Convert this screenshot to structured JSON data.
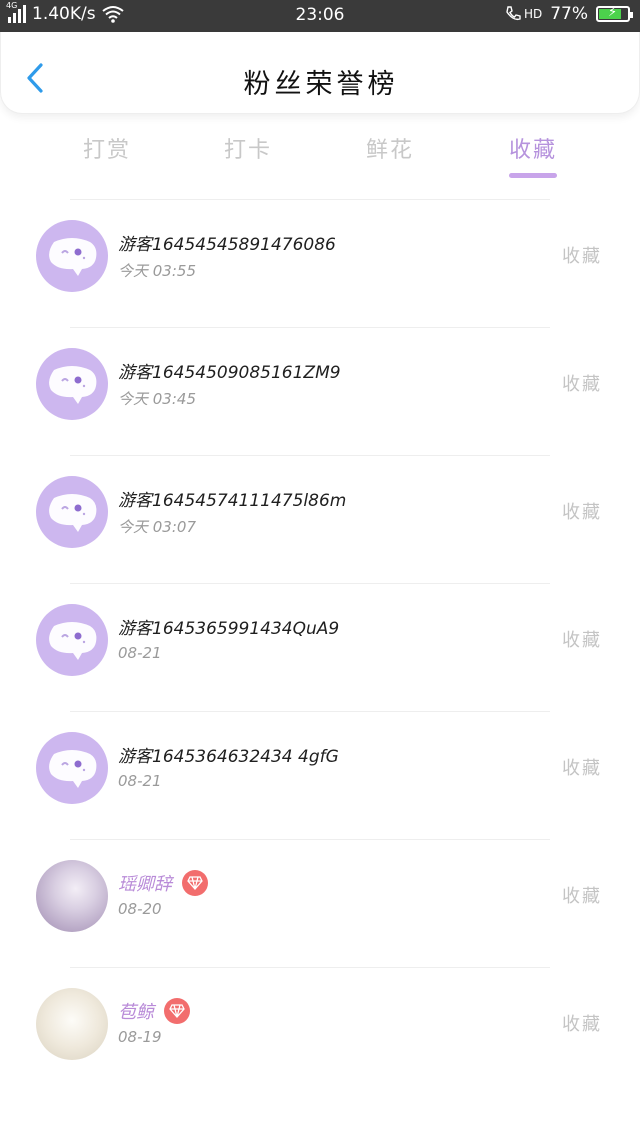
{
  "status_bar": {
    "network": "4G",
    "speed": "1.40K/s",
    "time": "23:06",
    "hd": "HD",
    "battery": "77%",
    "battery_level": 0.77,
    "battery_color": "#4cd24c"
  },
  "header": {
    "title": "粉丝荣誉榜",
    "back_icon": "chevron-left-icon"
  },
  "tabs": [
    {
      "label": "打赏",
      "active": false
    },
    {
      "label": "打卡",
      "active": false
    },
    {
      "label": "鲜花",
      "active": false
    },
    {
      "label": "收藏",
      "active": true
    }
  ],
  "colors": {
    "accent": "#b693dd",
    "guest_avatar": "#cdb7ef",
    "badge": "#f26d6d"
  },
  "fans": [
    {
      "name": "游客16454545891476086",
      "date": "今天 03:55",
      "action": "收藏",
      "avatar": "guest"
    },
    {
      "name": "游客16454509085161ZM9",
      "date": "今天 03:45",
      "action": "收藏",
      "avatar": "guest"
    },
    {
      "name": "游客16454574111475l86m",
      "date": "今天 03:07",
      "action": "收藏",
      "avatar": "guest"
    },
    {
      "name": "游客1645365991434QuA9",
      "date": "08-21",
      "action": "收藏",
      "avatar": "guest"
    },
    {
      "name": "游客1645364632434 4gfG",
      "date": "08-21",
      "action": "收藏",
      "avatar": "guest"
    },
    {
      "name": "瑶卿辞",
      "date": "08-20",
      "action": "收藏",
      "avatar": "photo",
      "badge": "diamond-icon"
    },
    {
      "name": "苞鲸",
      "date": "08-19",
      "action": "收藏",
      "avatar": "photo",
      "badge": "diamond-icon"
    }
  ]
}
